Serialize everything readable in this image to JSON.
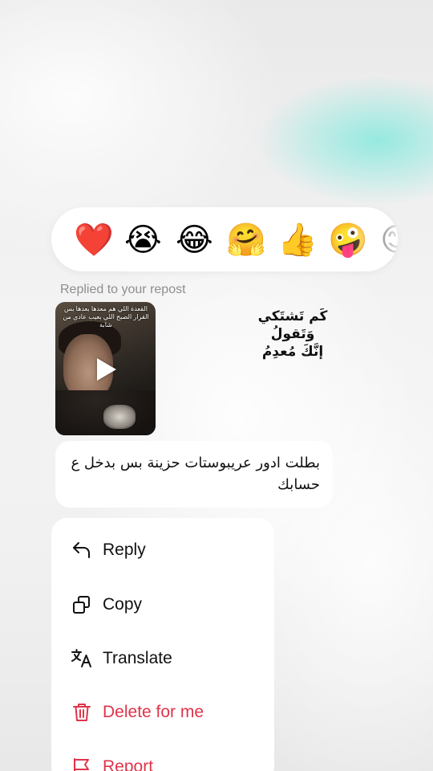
{
  "reactions": [
    {
      "name": "red-heart",
      "glyph": "❤️"
    },
    {
      "name": "loudly-crying-face",
      "glyph": "😭"
    },
    {
      "name": "face-with-tears-of-joy",
      "glyph": "😂"
    },
    {
      "name": "hugging-face",
      "glyph": "🤗"
    },
    {
      "name": "thumbs-up",
      "glyph": "👍"
    },
    {
      "name": "zany-face",
      "glyph": "🤪"
    },
    {
      "name": "partial-emoji",
      "glyph": "😊"
    }
  ],
  "replied_label": "Replied to your repost",
  "repost": {
    "caption": "القعدة اللي هم معدها بعدها بس القرار الصبح اللي بعيب عادي من شابة",
    "media_type": "video"
  },
  "overlay_text": {
    "line1": "كَم تَشتَكي وَتَقولُ",
    "line2": "إنَّكَ مُعدِمُ"
  },
  "message": {
    "text": "بطلت ادور عريبوستات حزينة بس بدخل ع حسابك"
  },
  "menu": {
    "items": [
      {
        "label": "Reply",
        "icon": "reply-icon",
        "danger": false
      },
      {
        "label": "Copy",
        "icon": "copy-icon",
        "danger": false
      },
      {
        "label": "Translate",
        "icon": "translate-icon",
        "danger": false
      },
      {
        "label": "Delete for me",
        "icon": "trash-icon",
        "danger": true
      },
      {
        "label": "Report",
        "icon": "report-flag-icon",
        "danger": true
      }
    ]
  },
  "colors": {
    "danger": "#e0334a",
    "accent_glow": "#78e8dc"
  }
}
